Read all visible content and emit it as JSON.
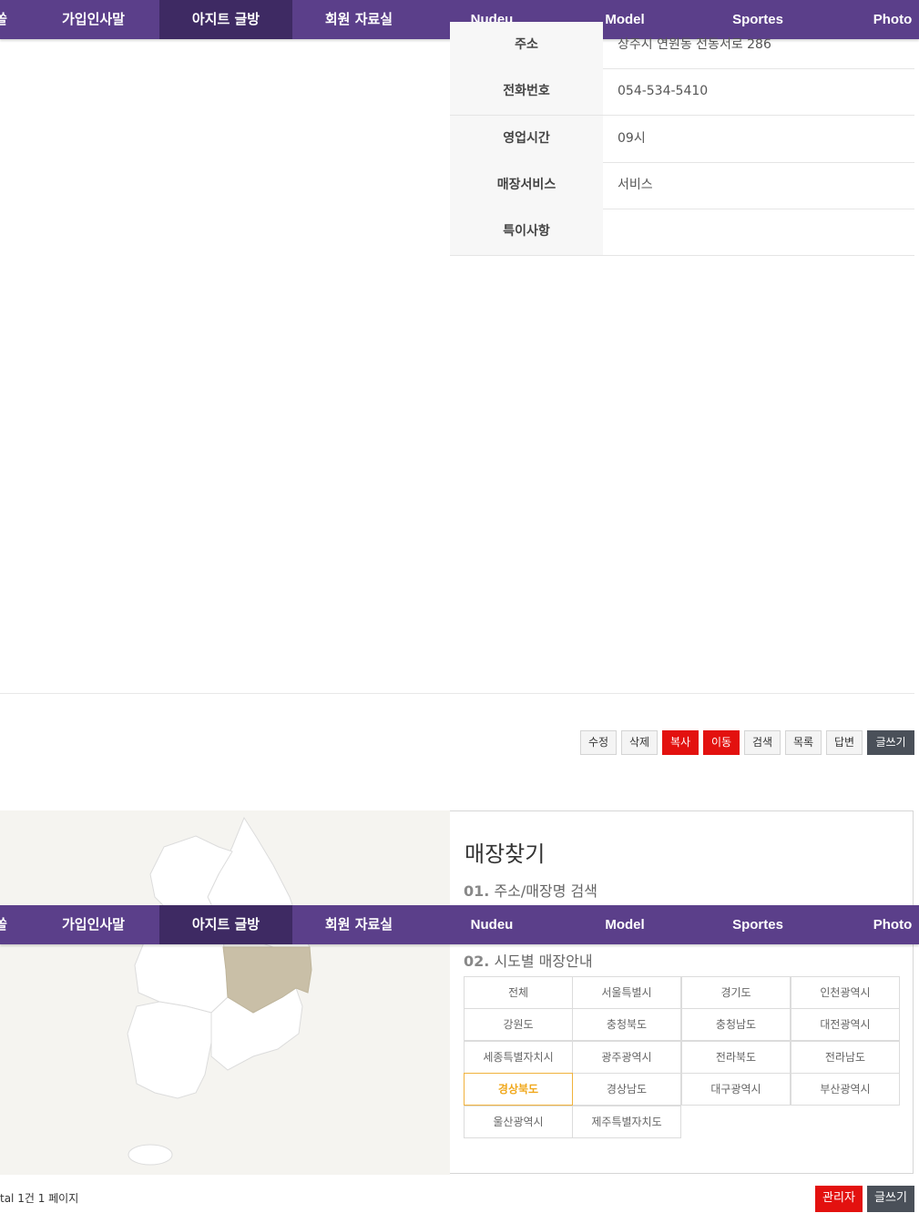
{
  "nav": {
    "items": [
      {
        "label": "쏠"
      },
      {
        "label": "가입인사말"
      },
      {
        "label": "아지트 글방"
      },
      {
        "label": "회원 자료실"
      },
      {
        "label": "Nudeu"
      },
      {
        "label": "Model"
      },
      {
        "label": "Sportes"
      },
      {
        "label": "Photo"
      }
    ]
  },
  "store_info": {
    "rows": [
      {
        "label": "주소",
        "value": "상주시 연원동 전동서로 286"
      },
      {
        "label": "전화번호",
        "value": "054-534-5410"
      },
      {
        "label": "영업시간",
        "value": "09시"
      },
      {
        "label": "매장서비스",
        "value": "서비스"
      },
      {
        "label": "특이사항",
        "value": ""
      }
    ]
  },
  "actions": {
    "edit": "수정",
    "delete": "삭제",
    "copy": "복사",
    "move": "이동",
    "search": "검색",
    "list": "목록",
    "reply": "답변",
    "write": "글쓰기"
  },
  "store_finder": {
    "title": "매장찾기",
    "step1_num": "01.",
    "step1_label": "주소/매장명 검색",
    "step2_num": "02.",
    "step2_label": "시도별 매장안내",
    "regions": [
      "전체",
      "서울특별시",
      "경기도",
      "인천광역시",
      "강원도",
      "충청북도",
      "충청남도",
      "대전광역시",
      "세종특별자치시",
      "광주광역시",
      "전라북도",
      "전라남도",
      "경상북도",
      "경상남도",
      "대구광역시",
      "부산광역시",
      "울산광역시",
      "제주특별자치도"
    ],
    "selected_region": "경상북도",
    "map_highlight_color": "#c9bfa7"
  },
  "footer": {
    "total": "tal 1건 1 페이지",
    "admin": "관리자",
    "write": "글쓰기"
  }
}
